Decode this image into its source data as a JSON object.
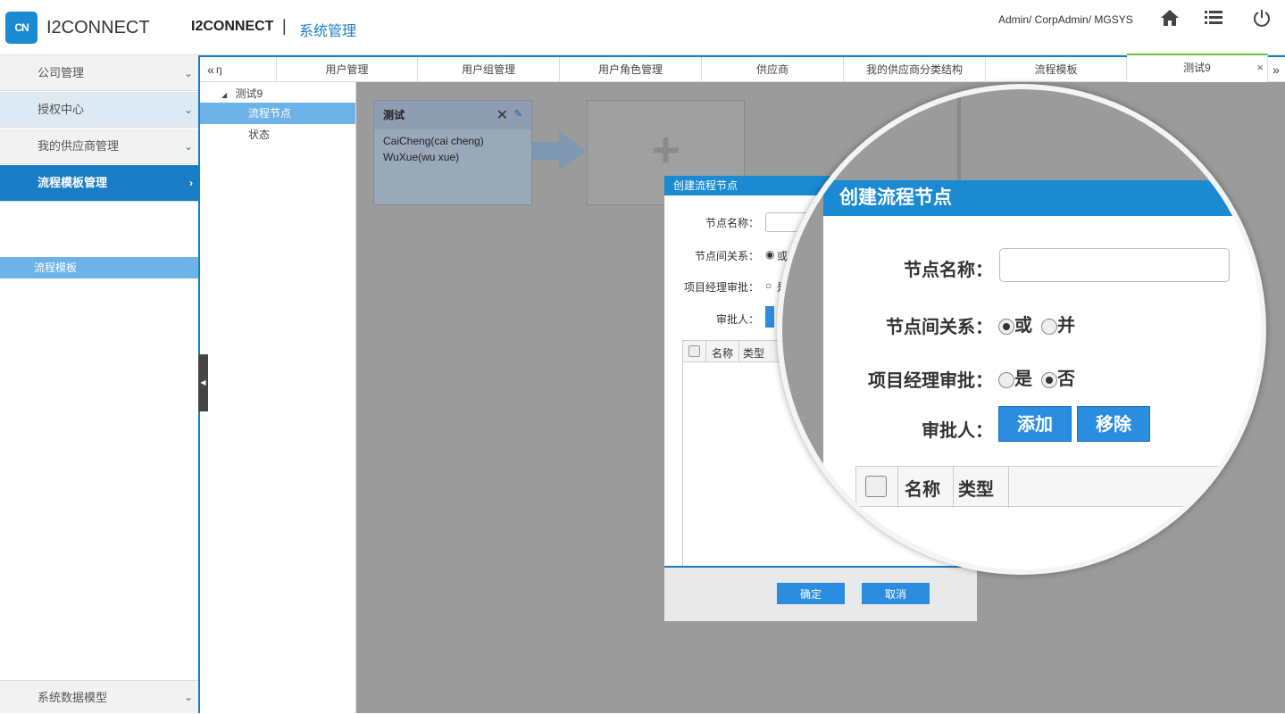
{
  "header": {
    "logo_mark": "CN",
    "logo_text": "I2CONNECT",
    "app_name": "I2CONNECT",
    "separator": "|",
    "module": "系统管理",
    "user": "Admin/ CorpAdmin/ MGSYS",
    "icons": [
      "home-icon",
      "list-icon",
      "power-icon"
    ]
  },
  "sidebar": {
    "items": [
      {
        "label": "公司管理"
      },
      {
        "label": "授权中心"
      },
      {
        "label": "我的供应商管理"
      },
      {
        "label": "流程模板管理"
      }
    ],
    "sub_item": "流程模板",
    "bottom_item": "系统数据模型"
  },
  "tabs": {
    "prev": "«",
    "first_partial": "ŋ",
    "items": [
      "用户管理",
      "用户组管理",
      "用户角色管理",
      "供应商",
      "我的供应商分类结构",
      "流程模板",
      "测试9"
    ],
    "close": "×",
    "next": "»"
  },
  "tree": {
    "root": "测试9",
    "nodes": [
      "流程节点",
      "状态"
    ]
  },
  "canvas": {
    "card_title": "测试",
    "card_users": [
      "CaiCheng(cai cheng)",
      "WuXue(wu xue)"
    ],
    "add_symbol": "+"
  },
  "dialog": {
    "title": "创建流程节点",
    "name_label": "节点名称：",
    "relation_label": "节点间关系：",
    "relation_option_visible": "或",
    "pm_label": "项目经理审批：",
    "pm_option_visible": "是",
    "approver_label": "审批人：",
    "col_name": "名称",
    "col_type": "类型",
    "ok": "确定",
    "cancel": "取消"
  },
  "magnifier": {
    "title": "创建流程节点",
    "name_label": "节点名称：",
    "relation_label": "节点间关系：",
    "relation_or": "或",
    "relation_and": "并",
    "pm_label": "项目经理审批：",
    "pm_yes": "是",
    "pm_no": "否",
    "approver_label": "审批人：",
    "add": "添加",
    "remove": "移除",
    "col_name": "名称",
    "col_type": "类型"
  }
}
